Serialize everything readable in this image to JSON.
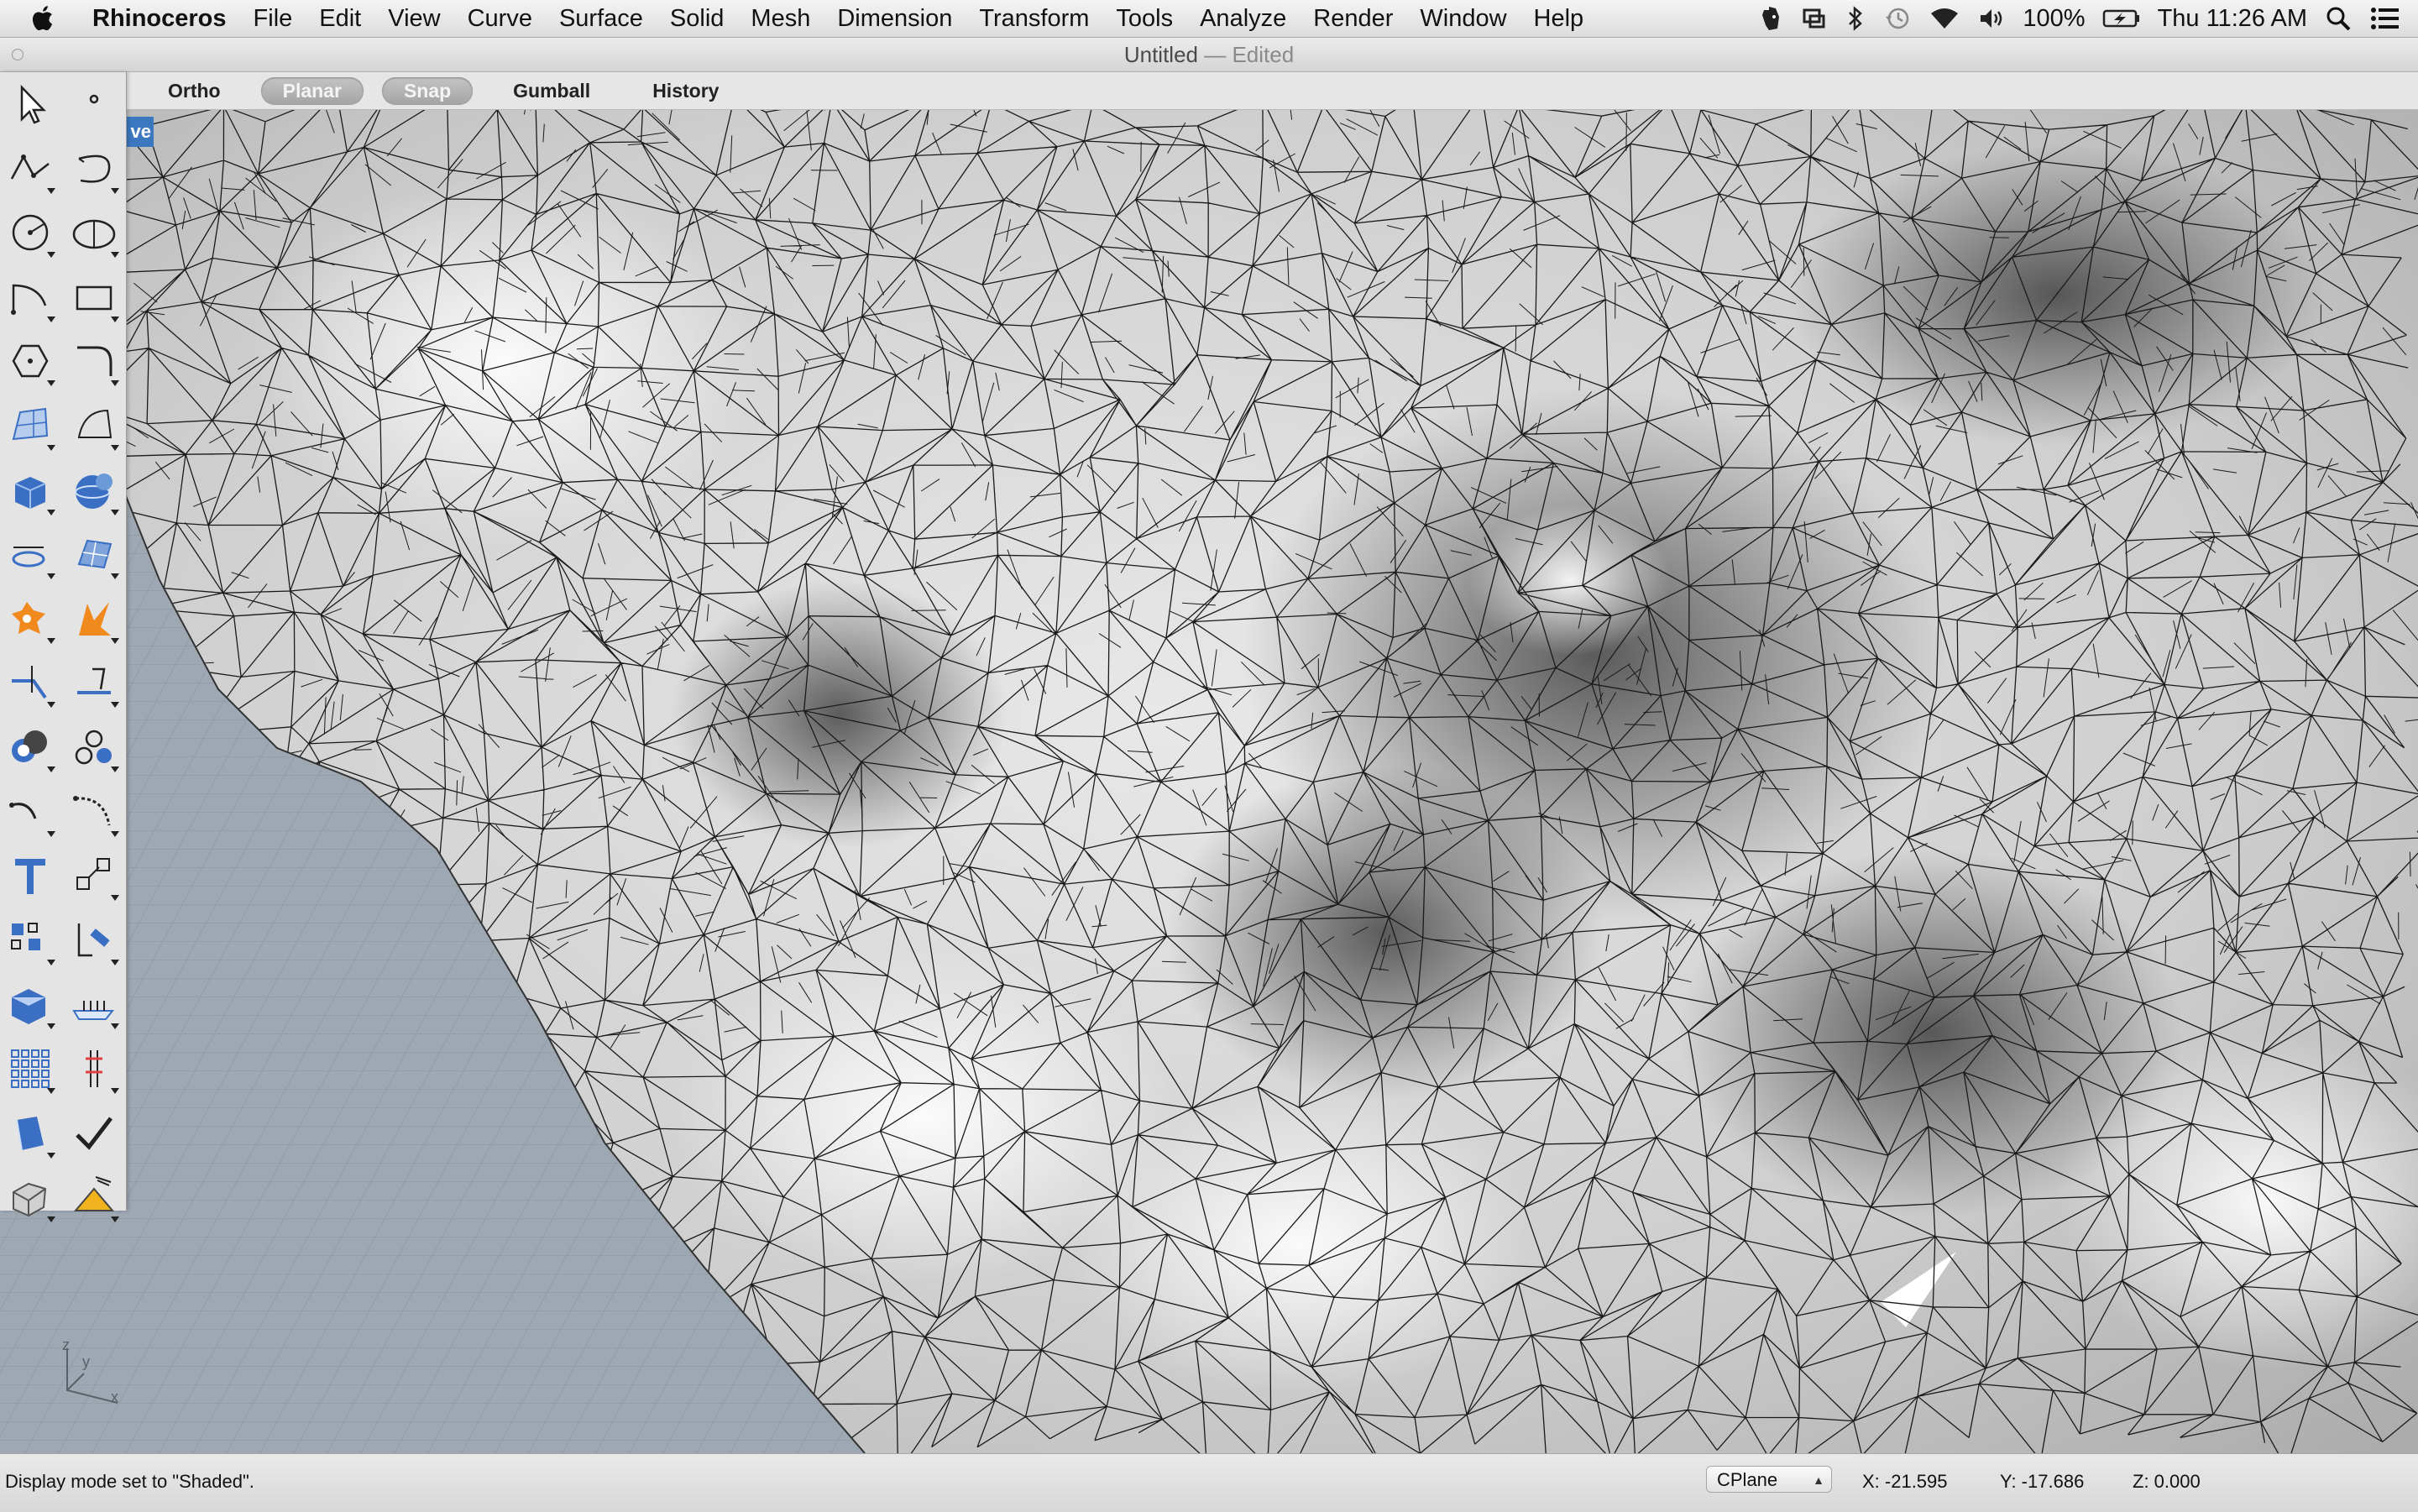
{
  "menubar": {
    "app_name": "Rhinoceros",
    "items": [
      "File",
      "Edit",
      "View",
      "Curve",
      "Surface",
      "Solid",
      "Mesh",
      "Dimension",
      "Transform",
      "Tools",
      "Analyze",
      "Render",
      "Window",
      "Help"
    ],
    "battery": "100%",
    "clock": "Thu 11:26 AM"
  },
  "window": {
    "title": "Untitled",
    "state": "— Edited"
  },
  "modebar": {
    "toggles": [
      {
        "label": "Ortho",
        "active": false
      },
      {
        "label": "Planar",
        "active": true
      },
      {
        "label": "Snap",
        "active": true
      },
      {
        "label": "Gumball",
        "active": false
      },
      {
        "label": "History",
        "active": false
      }
    ]
  },
  "viewport": {
    "label": "ve",
    "axes": {
      "z": "z",
      "y": "y",
      "x": "x"
    }
  },
  "palette": {
    "tools": [
      "select-arrow-icon",
      "point-icon",
      "polyline-icon",
      "curve-icon",
      "circle-icon",
      "ellipse-icon",
      "arc-icon",
      "rectangle-icon",
      "polygon-icon",
      "fillet-curve-icon",
      "surface-from-points-icon",
      "surface-patch-icon",
      "box-solid-icon",
      "sphere-solid-icon",
      "extrude-icon",
      "planar-surface-icon",
      "boolean-icon",
      "explode-icon",
      "trim-icon",
      "split-icon",
      "boolean-union-icon",
      "group-icon",
      "fillet-edge-icon",
      "blend-icon",
      "text-icon",
      "scale-icon",
      "array-icon",
      "orient-icon",
      "display-mode-icon",
      "grid-icon",
      "grid-array-icon",
      "dimension-icon",
      "render-icon",
      "check-icon",
      "solid-tools-icon",
      "analysis-icon"
    ]
  },
  "statusbar": {
    "message": "Display mode set to \"Shaded\".",
    "cplane": "CPlane",
    "x": "X: -21.595",
    "y": "Y: -17.686",
    "z": "Z: 0.000"
  }
}
